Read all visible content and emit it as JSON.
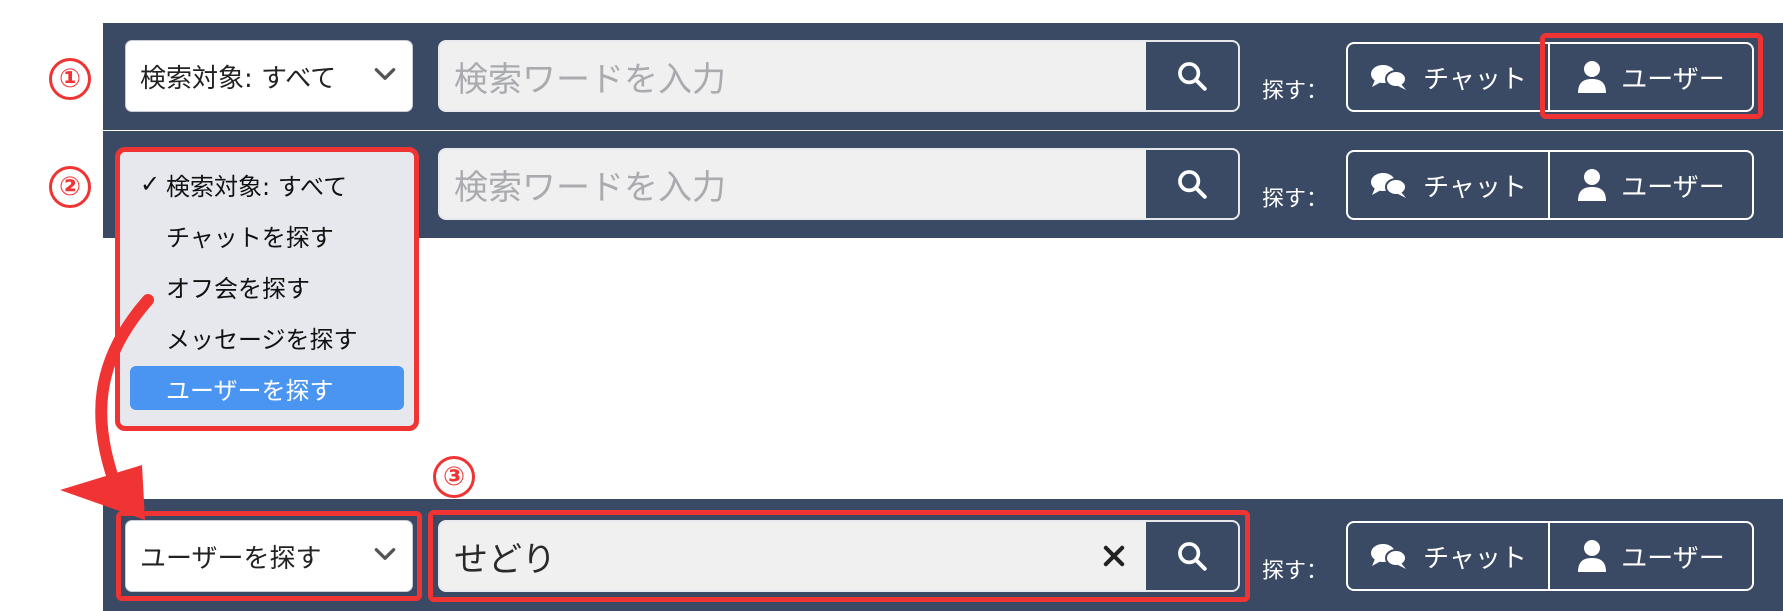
{
  "badges": [
    "①",
    "②",
    "③"
  ],
  "rows": [
    {
      "select_label": "検索対象: すべて",
      "search_placeholder": "検索ワードを入力",
      "search_value": "",
      "find_label": "探す：",
      "chat_label": "チャット",
      "user_label": "ユーザー"
    },
    {
      "select_label": "",
      "search_placeholder": "検索ワードを入力",
      "search_value": "",
      "find_label": "探す：",
      "chat_label": "チャット",
      "user_label": "ユーザー"
    },
    {
      "select_label": "ユーザーを探す",
      "search_placeholder": "",
      "search_value": "せどり",
      "find_label": "探す：",
      "chat_label": "チャット",
      "user_label": "ユーザー"
    }
  ],
  "dropdown": {
    "options": [
      {
        "label": "検索対象: すべて",
        "checked": true
      },
      {
        "label": "チャットを探す"
      },
      {
        "label": "オフ会を探す"
      },
      {
        "label": "メッセージを探す"
      },
      {
        "label": "ユーザーを探す",
        "highlighted": true
      }
    ],
    "check_mark": "✓"
  },
  "colors": {
    "bar": "#3a4a64",
    "highlight": "#f03434",
    "selected_option": "#4b95f2"
  },
  "icons": [
    "chevron-down-icon",
    "search-icon",
    "chat-bubbles-icon",
    "user-icon",
    "clear-icon",
    "curved-arrow"
  ]
}
